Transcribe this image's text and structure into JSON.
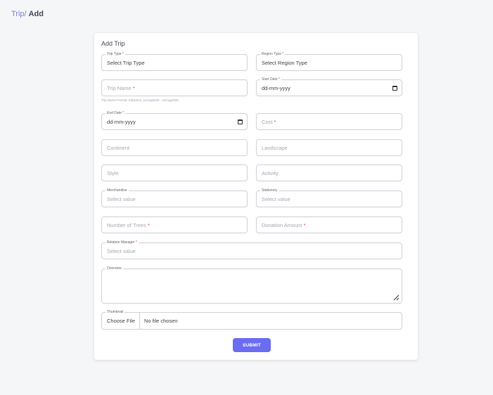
{
  "breadcrumb": {
    "parent": "Trip/",
    "current": "Add"
  },
  "form": {
    "title": "Add Trip",
    "trip_type": {
      "label": "Trip Type",
      "value": "Select Trip Type"
    },
    "region_type": {
      "label": "Region Type",
      "value": "Select Region Type"
    },
    "trip_name": {
      "placeholder": "Trip Name"
    },
    "trip_name_hint": "Trip Name Format: tripName_12Aug2025 - 18Aug2025.",
    "start_date": {
      "label": "Start Date",
      "value": "dd-mm-yyyy"
    },
    "end_date": {
      "label": "End Date",
      "value": "dd-mm-yyyy"
    },
    "cost": {
      "placeholder": "Cost"
    },
    "continent": {
      "placeholder": "Continent"
    },
    "landscape": {
      "placeholder": "Landscape"
    },
    "style": {
      "placeholder": "Style"
    },
    "activity": {
      "placeholder": "Activity"
    },
    "merchandise": {
      "label": "Merchandise",
      "placeholder": "Select value"
    },
    "stationery": {
      "label": "Stationery",
      "placeholder": "Select value"
    },
    "number_of_trees": {
      "placeholder": "Number of Trees"
    },
    "donation_amount": {
      "placeholder": "Donation Amount"
    },
    "relation_manager": {
      "label": "Relation Manager",
      "placeholder": "Select value"
    },
    "overview": {
      "label": "Overview"
    },
    "thumbnail": {
      "label": "Thumbnail",
      "button": "Choose File",
      "status": "No file chosen"
    },
    "required_mark": "*",
    "submit_label": "SUBMIT"
  },
  "colors": {
    "accent": "#6a6cf2",
    "required": "#e0457b",
    "background": "#f5f6f8"
  }
}
